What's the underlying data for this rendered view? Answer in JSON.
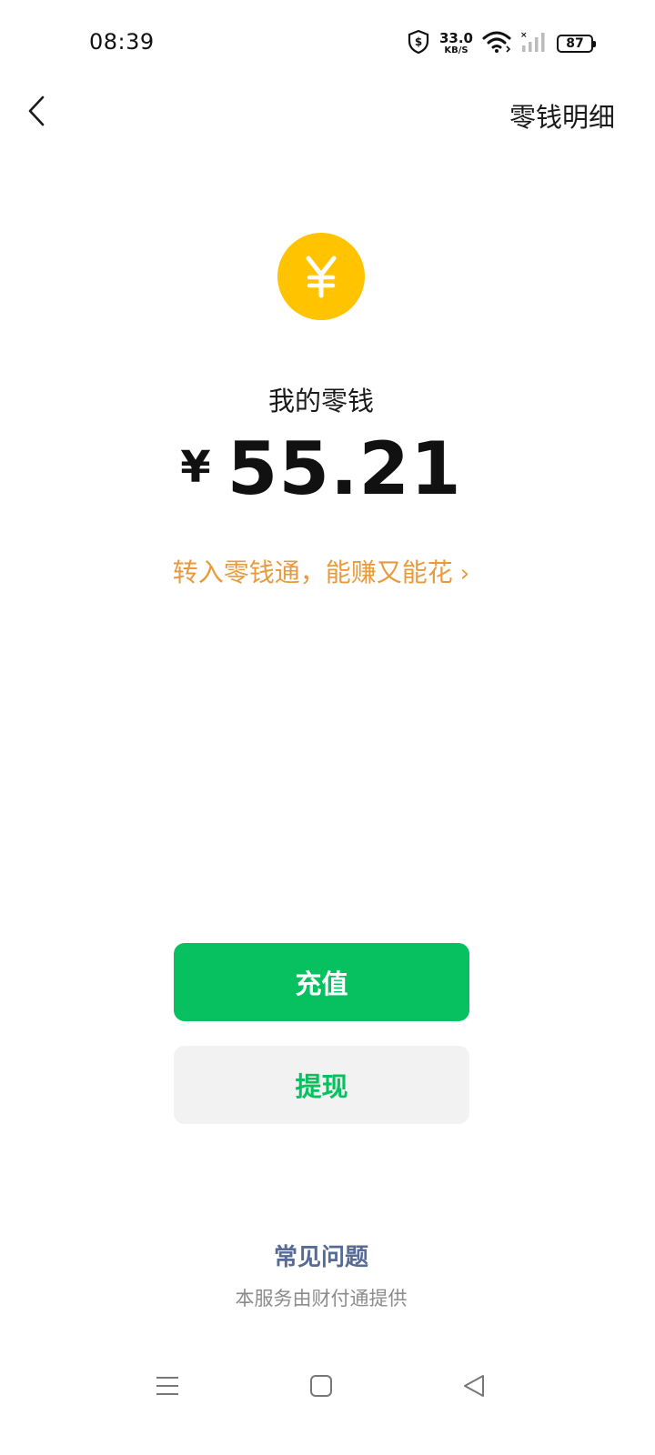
{
  "status_bar": {
    "time": "08:39",
    "net_speed_value": "33.0",
    "net_speed_unit": "KB/S",
    "battery_level": "87",
    "icons": [
      "shield-dollar-icon",
      "wifi-icon",
      "signal-icon"
    ]
  },
  "nav": {
    "back_icon": "chevron-left-icon",
    "detail_label": "零钱明细"
  },
  "wallet": {
    "coin_icon": "yen-coin-icon",
    "label": "我的零钱",
    "currency_symbol": "¥",
    "balance": "55.21"
  },
  "promo": {
    "text": "转入零钱通，能赚又能花",
    "chevron": "›"
  },
  "actions": {
    "recharge_label": "充值",
    "withdraw_label": "提现"
  },
  "footer": {
    "faq_label": "常见问题",
    "provider_note": "本服务由财付通提供"
  },
  "system_nav": {
    "icons": [
      "menu-icon",
      "home-icon",
      "back-triangle-icon"
    ]
  },
  "colors": {
    "primary_green": "#07C160",
    "coin_yellow": "#FFC300",
    "promo_orange": "#E89A3C",
    "link_blue": "#576B95",
    "secondary_button_bg": "#F2F2F2"
  }
}
